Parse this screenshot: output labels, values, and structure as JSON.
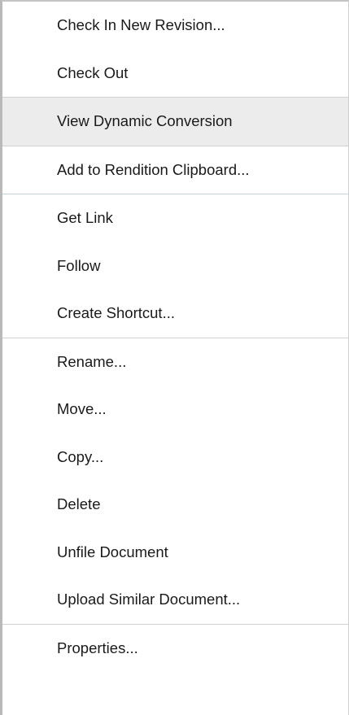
{
  "menu": {
    "groups": [
      {
        "items": [
          {
            "label": "Check In New Revision..."
          },
          {
            "label": "Check Out"
          }
        ]
      },
      {
        "items": [
          {
            "label": "View Dynamic Conversion",
            "highlighted": true
          }
        ]
      },
      {
        "items": [
          {
            "label": "Add to Rendition Clipboard..."
          }
        ]
      },
      {
        "items": [
          {
            "label": "Get Link"
          },
          {
            "label": "Follow"
          },
          {
            "label": "Create Shortcut..."
          }
        ]
      },
      {
        "items": [
          {
            "label": "Rename..."
          },
          {
            "label": "Move..."
          },
          {
            "label": "Copy..."
          },
          {
            "label": "Delete"
          },
          {
            "label": "Unfile Document"
          },
          {
            "label": "Upload Similar Document..."
          }
        ]
      },
      {
        "items": [
          {
            "label": "Properties..."
          }
        ]
      }
    ]
  },
  "colors": {
    "highlight_bg": "#ececec",
    "separator": "#c9d3dc",
    "text": "#1a1a1a"
  }
}
